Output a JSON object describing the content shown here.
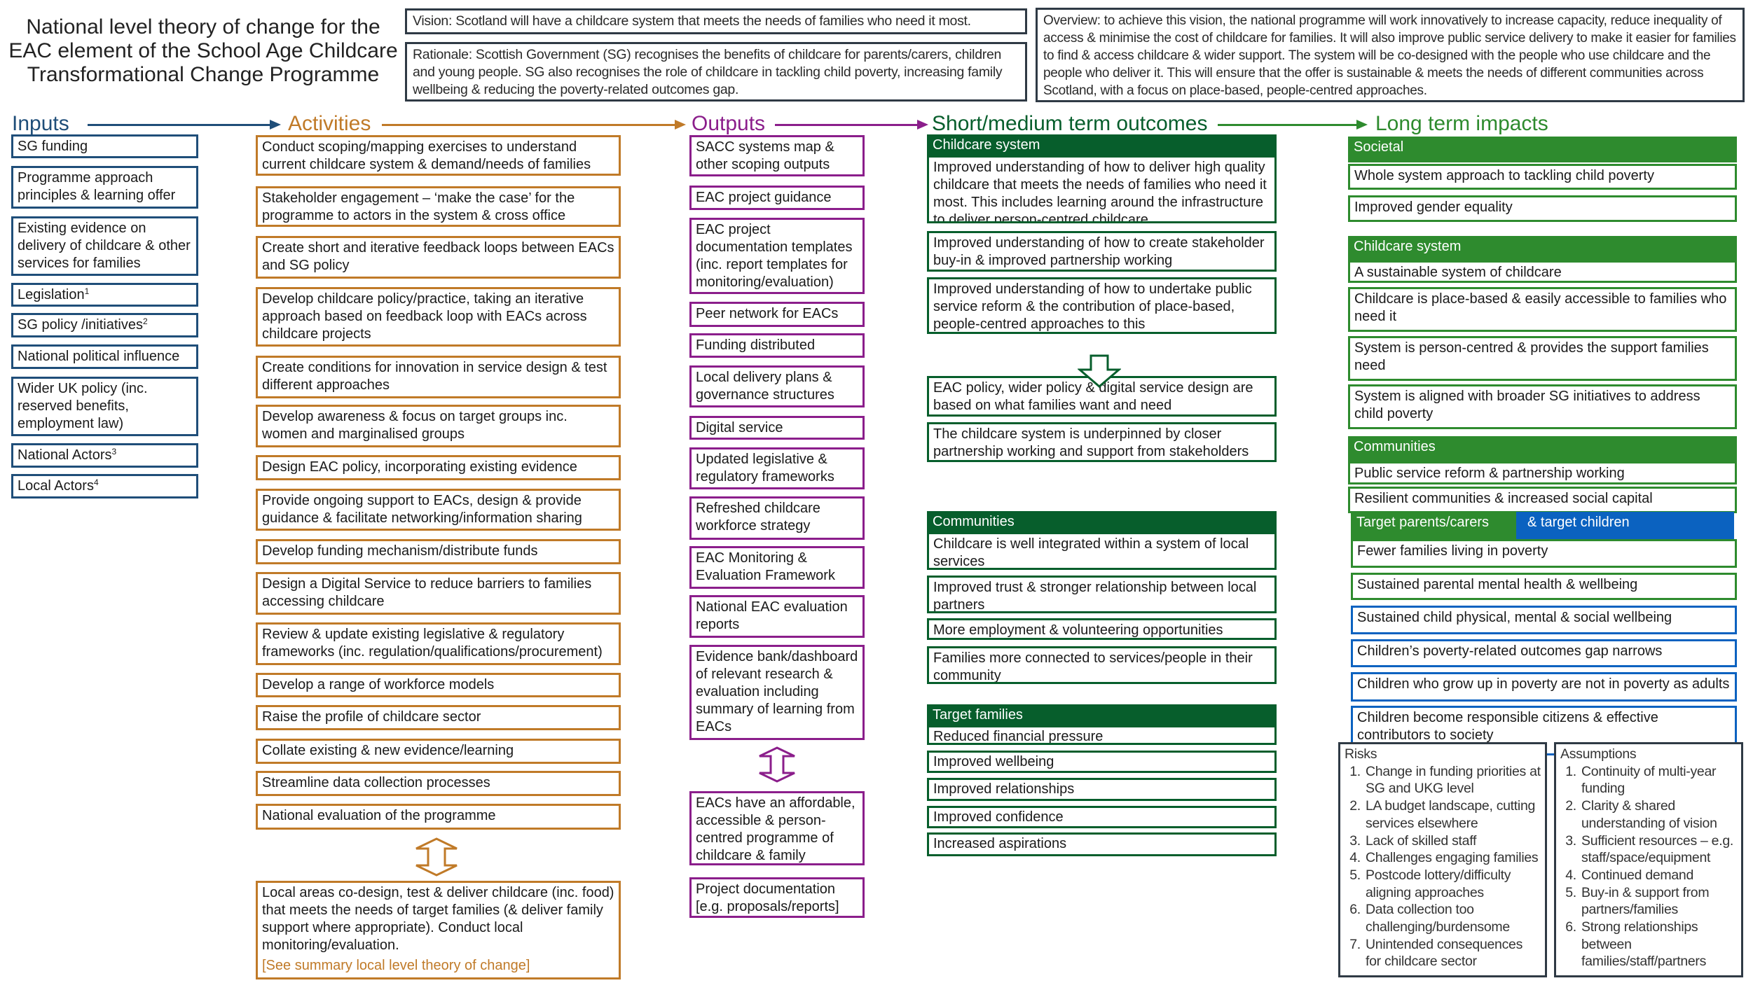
{
  "title": [
    "National level theory of change for the",
    "EAC element of the School Age Childcare",
    "Transformational Change Programme"
  ],
  "vision": "Vision: Scotland will have a childcare system that meets the needs of families who need it most.",
  "rationale": "Rationale: Scottish Government (SG) recognises the benefits of childcare for parents/carers, children and young people. SG also recognises the role of childcare in tackling child poverty, increasing family wellbeing & reducing the poverty-related outcomes gap.",
  "overview": "Overview: to achieve this vision, the national programme will work innovatively to increase capacity, reduce inequality of access & minimise the cost of childcare for families. It will also improve public service delivery to make it easier for families to find & access childcare & wider support. The system will be co-designed with the people who use childcare and the people who deliver it. This will ensure that the offer is sustainable & meets the needs of different communities across Scotland, with a focus on place-based, people-centred approaches.",
  "colors": {
    "inputs": "#1f4e79",
    "activities": "#c07a28",
    "outputs": "#8b1e8b",
    "short_medium": "#075e2c",
    "long_term": "#2e8b2e",
    "children": "#0b62c0",
    "frame": "#2f3a45"
  },
  "columns": {
    "inputs": "Inputs",
    "activities": "Activities",
    "outputs": "Outputs",
    "short_medium": "Short/medium term outcomes",
    "long_term": "Long term impacts"
  },
  "inputs": [
    {
      "text": "SG funding",
      "sup": ""
    },
    {
      "text": "Programme approach principles & learning offer",
      "sup": ""
    },
    {
      "text": "Existing evidence on delivery of childcare & other services for families",
      "sup": ""
    },
    {
      "text": "Legislation",
      "sup": "1"
    },
    {
      "text": "SG policy /initiatives",
      "sup": "2"
    },
    {
      "text": "National political influence",
      "sup": ""
    },
    {
      "text": "Wider UK policy (inc. reserved benefits, employment law)",
      "sup": ""
    },
    {
      "text": "National Actors",
      "sup": "3"
    },
    {
      "text": "Local Actors",
      "sup": "4"
    }
  ],
  "activities": [
    "Conduct scoping/mapping exercises to understand current childcare system & demand/needs of families",
    "Stakeholder engagement – ‘make the case’ for the programme to actors in the system & cross office",
    "Create short and iterative feedback loops between EACs and SG policy",
    "Develop childcare policy/practice, taking an iterative approach based on feedback loop with EACs across childcare projects",
    "Create conditions for innovation in service design & test different approaches",
    "Develop awareness & focus on target groups inc. women and marginalised groups",
    "Design EAC policy, incorporating existing evidence",
    "Provide ongoing support to EACs, design & provide guidance & facilitate networking/information sharing",
    "Develop funding mechanism/distribute funds",
    "Design a Digital Service to reduce barriers to families accessing childcare",
    "Review & update existing legislative & regulatory frameworks (inc. regulation/qualifications/procurement)",
    "Develop a range of workforce models",
    "Raise the profile of childcare sector",
    "Collate existing & new evidence/learning",
    "Streamline data collection processes",
    "National evaluation of the programme"
  ],
  "local_activity": {
    "text": "Local areas co-design, test & deliver childcare (inc. food) that meets the needs of target families (& deliver family support where appropriate). Conduct local monitoring/evaluation.",
    "link": "[See summary local level theory of change]"
  },
  "outputs": [
    "SACC systems map & other scoping outputs",
    "EAC project guidance",
    "EAC project documentation templates (inc. report templates for monitoring/evaluation)",
    "Peer network for EACs",
    "Funding distributed",
    "Local delivery plans & governance structures",
    "Digital service",
    "Updated legislative & regulatory frameworks",
    "Refreshed childcare workforce strategy",
    "EAC Monitoring & Evaluation Framework",
    "National EAC evaluation reports",
    "Evidence bank/dashboard of relevant research & evaluation including summary of learning from EACs"
  ],
  "local_outputs": [
    "EACs have an affordable, accessible & person-centred programme of childcare & family support.",
    "Project documentation [e.g. proposals/reports]"
  ],
  "short_medium": {
    "childcare_system": {
      "header": "Childcare system",
      "items": [
        "Improved understanding of how to deliver high quality childcare that meets the needs of families who need it most. This includes learning around the infrastructure to deliver person-centred childcare.",
        "Improved understanding of how to create stakeholder buy-in & improved partnership working",
        "Improved understanding of how to undertake public service reform & the contribution of place-based, people-centred approaches to this"
      ],
      "after_arrow": [
        "EAC policy, wider policy & digital service design are based on what families want and need",
        "The childcare system is underpinned by closer partnership working and support from stakeholders"
      ]
    },
    "communities": {
      "header": "Communities",
      "items": [
        "Childcare is well integrated within a system of local services",
        "Improved trust & stronger relationship between local partners",
        "More employment & volunteering opportunities",
        "Families more connected to services/people in their community"
      ]
    },
    "target_families": {
      "header": "Target families",
      "items": [
        "Reduced financial pressure",
        "Improved wellbeing",
        "Improved relationships",
        "Improved confidence",
        "Increased aspirations"
      ]
    }
  },
  "long_term": {
    "societal": {
      "header": "Societal",
      "items": [
        "Whole system approach to tackling child poverty",
        "Improved gender equality"
      ]
    },
    "childcare_system": {
      "header": "Childcare system",
      "items": [
        "A sustainable system of childcare",
        "Childcare is place-based & easily accessible to families who need it",
        "System is person-centred & provides the support families need",
        "System is aligned with broader SG initiatives to address child poverty"
      ]
    },
    "communities": {
      "header": "Communities",
      "items": [
        "Public service reform & partnership working",
        "Resilient communities & increased social capital"
      ]
    },
    "target": {
      "header_parents": "Target parents/carers",
      "header_children": "& target children",
      "parent_items": [
        "Fewer families living in poverty",
        "Sustained parental mental health & wellbeing"
      ],
      "child_items": [
        "Sustained child physical, mental & social wellbeing",
        "Children’s poverty-related outcomes gap narrows",
        "Children who grow up in poverty are not in poverty as adults",
        "Children become responsible citizens & effective contributors to society"
      ]
    }
  },
  "risks": {
    "title": "Risks",
    "items": [
      "Change in funding priorities at SG and UKG level",
      "LA budget landscape, cutting services elsewhere",
      "Lack of skilled staff",
      "Challenges engaging families",
      "Postcode lottery/difficulty aligning approaches",
      "Data collection too challenging/burdensome",
      "Unintended consequences for childcare sector"
    ]
  },
  "assumptions": {
    "title": "Assumptions",
    "items": [
      "Continuity of multi-year funding",
      "Clarity & shared understanding of vision",
      "Sufficient resources – e.g. staff/space/equipment",
      "Continued demand",
      "Buy-in & support from partners/families",
      "Strong relationships between families/staff/partners"
    ]
  }
}
